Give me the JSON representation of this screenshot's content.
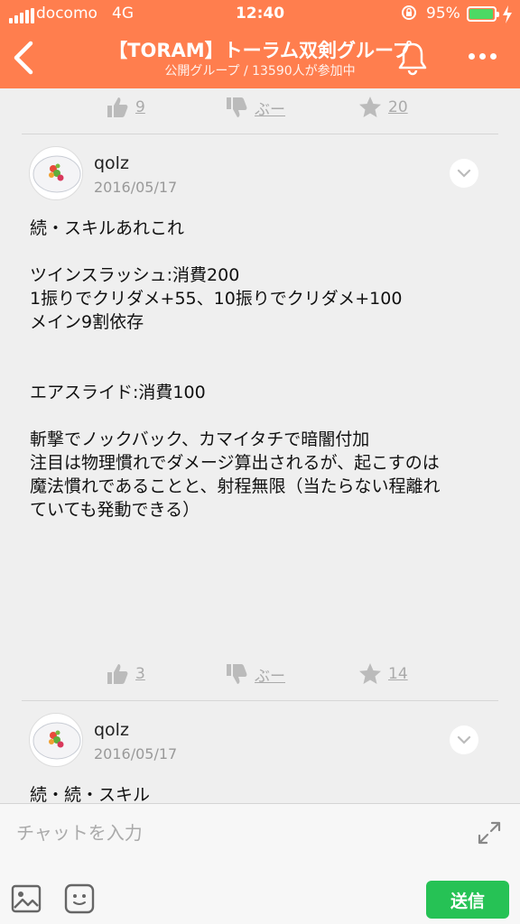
{
  "status": {
    "carrier": "docomo",
    "network": "4G",
    "time": "12:40",
    "battery": "95%",
    "battery_level": 0.95
  },
  "header": {
    "title": "【TORAM】トーラム双剣グループ",
    "subtitle": "公開グループ / 13590人が参加中",
    "icons": {
      "back": "chevron-left-icon",
      "notifications": "bell-icon",
      "more": "more-icon"
    }
  },
  "top_reactions": {
    "likes": "9",
    "boo": "ぶー",
    "stars": "20"
  },
  "posts": [
    {
      "username": "qolz",
      "date": "2016/05/17",
      "body": [
        "続・スキルあれこれ",
        "",
        "ツインスラッシュ:消費200",
        "1振りでクリダメ+55、10振りでクリダメ+100",
        "メイン9割依存",
        "",
        "",
        "エアスライド:消費100",
        "",
        "斬撃でノックバック、カマイタチで暗闇付加",
        "注目は物理慣れでダメージ算出されるが、起こすのは",
        "魔法慣れであることと、射程無限（当たらない程離れ",
        "ていても発動できる）"
      ],
      "reactions": {
        "likes": "3",
        "boo": "ぶー",
        "stars": "14"
      }
    },
    {
      "username": "qolz",
      "date": "2016/05/17",
      "body": [
        "続・続・スキル"
      ]
    }
  ],
  "composer": {
    "placeholder": "チャットを入力",
    "send_label": "送信"
  },
  "colors": {
    "header": "#ff7e4e",
    "send": "#26c255",
    "battery": "#4cd964"
  }
}
